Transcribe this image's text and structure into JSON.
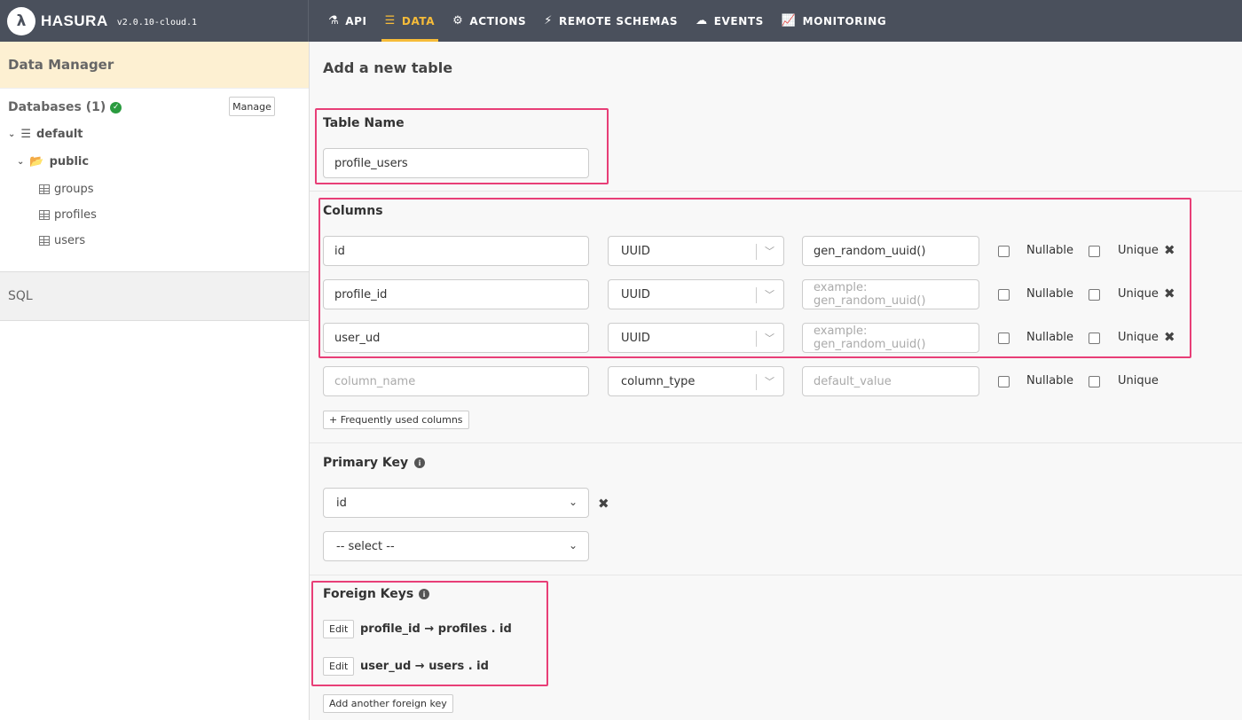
{
  "header": {
    "brand": "HASURA",
    "version": "v2.0.10-cloud.1",
    "nav": [
      {
        "label": "API",
        "icon": "flask-icon"
      },
      {
        "label": "DATA",
        "icon": "database-icon",
        "active": true
      },
      {
        "label": "ACTIONS",
        "icon": "cogs-icon"
      },
      {
        "label": "REMOTE SCHEMAS",
        "icon": "plug-icon"
      },
      {
        "label": "EVENTS",
        "icon": "cloud-icon"
      },
      {
        "label": "MONITORING",
        "icon": "line-chart-icon"
      }
    ]
  },
  "sidebar": {
    "title": "Data Manager",
    "databases_label": "Databases (1)",
    "manage_label": "Manage",
    "database": "default",
    "schema": "public",
    "tables": [
      "groups",
      "profiles",
      "users"
    ],
    "sql_label": "SQL"
  },
  "main": {
    "title": "Add a new table",
    "table_name_label": "Table Name",
    "table_name_value": "profile_users",
    "columns_label": "Columns",
    "columns": [
      {
        "name": "id",
        "type": "UUID",
        "default": "gen_random_uuid()",
        "default_is_placeholder": false
      },
      {
        "name": "profile_id",
        "type": "UUID",
        "default": "example: gen_random_uuid()",
        "default_is_placeholder": true
      },
      {
        "name": "user_ud",
        "type": "UUID",
        "default": "example: gen_random_uuid()",
        "default_is_placeholder": true
      }
    ],
    "new_column": {
      "name_placeholder": "column_name",
      "type_placeholder": "column_type",
      "default_placeholder": "default_value"
    },
    "nullable_label": "Nullable",
    "unique_label": "Unique",
    "frequent_columns_label": "+ Frequently used columns",
    "primary_key_label": "Primary Key",
    "primary_key_value": "id",
    "primary_key_select_placeholder": "-- select --",
    "foreign_keys_label": "Foreign Keys",
    "foreign_keys": [
      {
        "edit": "Edit",
        "text": "profile_id → profiles . id"
      },
      {
        "edit": "Edit",
        "text": "user_ud → users . id"
      }
    ],
    "add_fk_label": "Add another foreign key"
  },
  "colors": {
    "accent": "#f7bc39",
    "highlight": "#e83e77",
    "topbar": "#4a505c",
    "success": "#2a9b3f"
  }
}
